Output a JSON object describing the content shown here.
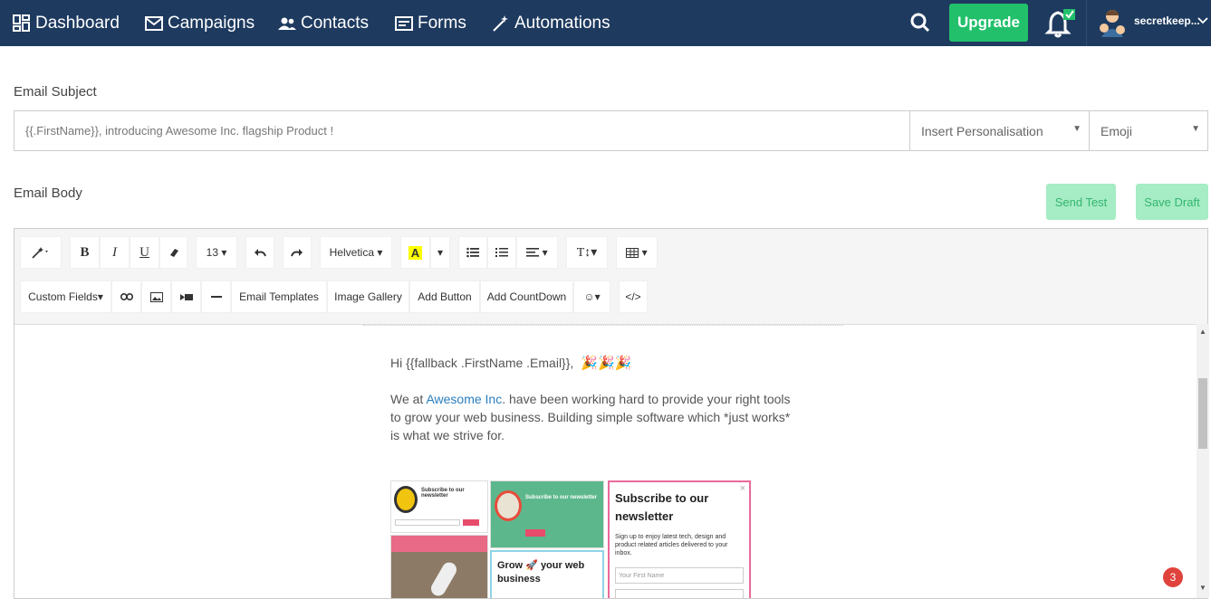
{
  "nav": {
    "items": [
      {
        "label": "Dashboard",
        "icon": "dashboard-icon"
      },
      {
        "label": "Campaigns",
        "icon": "mail-icon"
      },
      {
        "label": "Contacts",
        "icon": "contacts-icon"
      },
      {
        "label": "Forms",
        "icon": "forms-icon"
      },
      {
        "label": "Automations",
        "icon": "magic-wand-icon"
      }
    ],
    "upgrade_label": "Upgrade",
    "username": "secretkeep..."
  },
  "subject": {
    "label": "Email Subject",
    "value": "{{.FirstName}}, introducing Awesome Inc. flagship Product !",
    "personalisation": "Insert Personalisation",
    "emoji": "Emoji"
  },
  "body": {
    "label": "Email Body",
    "send_test": "Send Test",
    "save_draft": "Save Draft"
  },
  "toolbar": {
    "font_size": "13",
    "font_family": "Helvetica",
    "custom_fields": "Custom Fields",
    "email_templates": "Email Templates",
    "image_gallery": "Image Gallery",
    "add_button": "Add Button",
    "add_countdown": "Add CountDown",
    "code": "</>"
  },
  "content": {
    "greeting": "Hi {{fallback .FirstName .Email}},",
    "p1_pre": "We at ",
    "p1_link": "Awesome Inc",
    "p1_post": ". have been working hard to provide your right tools",
    "p2": "to grow your web business. Building simple software which *just works*",
    "p3": "is what we strive for.",
    "newsletter_small": "Subscribe to our newsletter",
    "newsletter_big_1": "Subscribe to our",
    "newsletter_big_2": "newsletter",
    "newsletter_desc": "Sign up to enjoy latest tech, design and product related articles delivered to your inbox.",
    "first_name_placeholder": "Your First Name",
    "grow_1": "Grow",
    "grow_2": "your web",
    "grow_3": "business"
  },
  "notifications_count": "3",
  "colors": {
    "nav": "#1e3a5f",
    "upgrade": "#22c06b",
    "link": "#2a7ec0",
    "badge": "#e0433c"
  }
}
